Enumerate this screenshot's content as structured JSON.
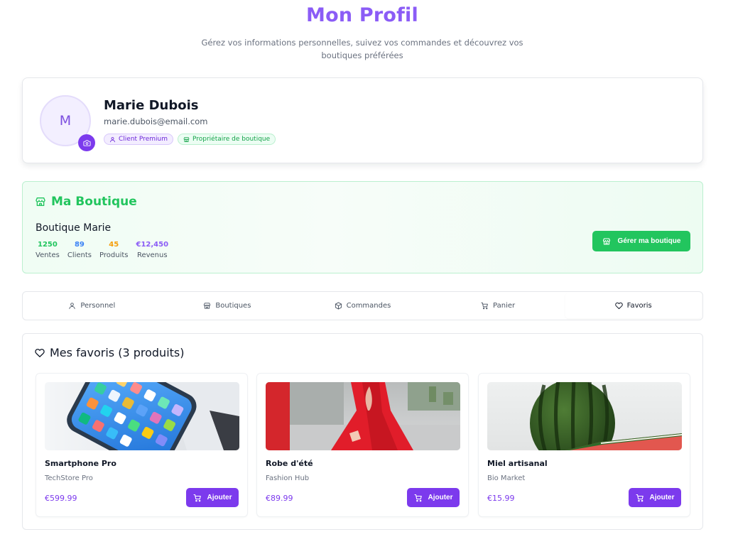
{
  "header": {
    "title": "Mon Profil",
    "subtitle": "Gérez vos informations personnelles, suivez vos commandes et découvrez vos boutiques préférées"
  },
  "profile": {
    "avatar_initial": "M",
    "name": "Marie Dubois",
    "email": "marie.dubois@email.com",
    "badges": [
      {
        "label": "Client Premium",
        "icon": "user-icon"
      },
      {
        "label": "Propriétaire de boutique",
        "icon": "store-icon"
      }
    ]
  },
  "shop": {
    "section_title": "Ma Boutique",
    "name": "Boutique Marie",
    "stats": [
      {
        "value": "1250",
        "label": "Ventes",
        "color": "#22c55e"
      },
      {
        "value": "89",
        "label": "Clients",
        "color": "#3b82f6"
      },
      {
        "value": "45",
        "label": "Produits",
        "color": "#f59e0b"
      },
      {
        "value": "€12,450",
        "label": "Revenus",
        "color": "#8b5cf6"
      }
    ],
    "manage_label": "Gérer ma boutique"
  },
  "tabs": [
    {
      "label": "Personnel",
      "icon": "user-icon",
      "active": false
    },
    {
      "label": "Boutiques",
      "icon": "store-icon",
      "active": false
    },
    {
      "label": "Commandes",
      "icon": "package-icon",
      "active": false
    },
    {
      "label": "Panier",
      "icon": "cart-icon",
      "active": false
    },
    {
      "label": "Favoris",
      "icon": "heart-icon",
      "active": true
    }
  ],
  "favorites": {
    "title": "Mes favoris (3 produits)",
    "add_label": "Ajouter",
    "products": [
      {
        "name": "Smartphone Pro",
        "store": "TechStore Pro",
        "price": "€599.99"
      },
      {
        "name": "Robe d'été",
        "store": "Fashion Hub",
        "price": "€89.99"
      },
      {
        "name": "Miel artisanal",
        "store": "Bio Market",
        "price": "€15.99"
      }
    ]
  },
  "colors": {
    "accent": "#8b5cf6",
    "button_purple": "#7c3aed",
    "success": "#22c55e"
  }
}
